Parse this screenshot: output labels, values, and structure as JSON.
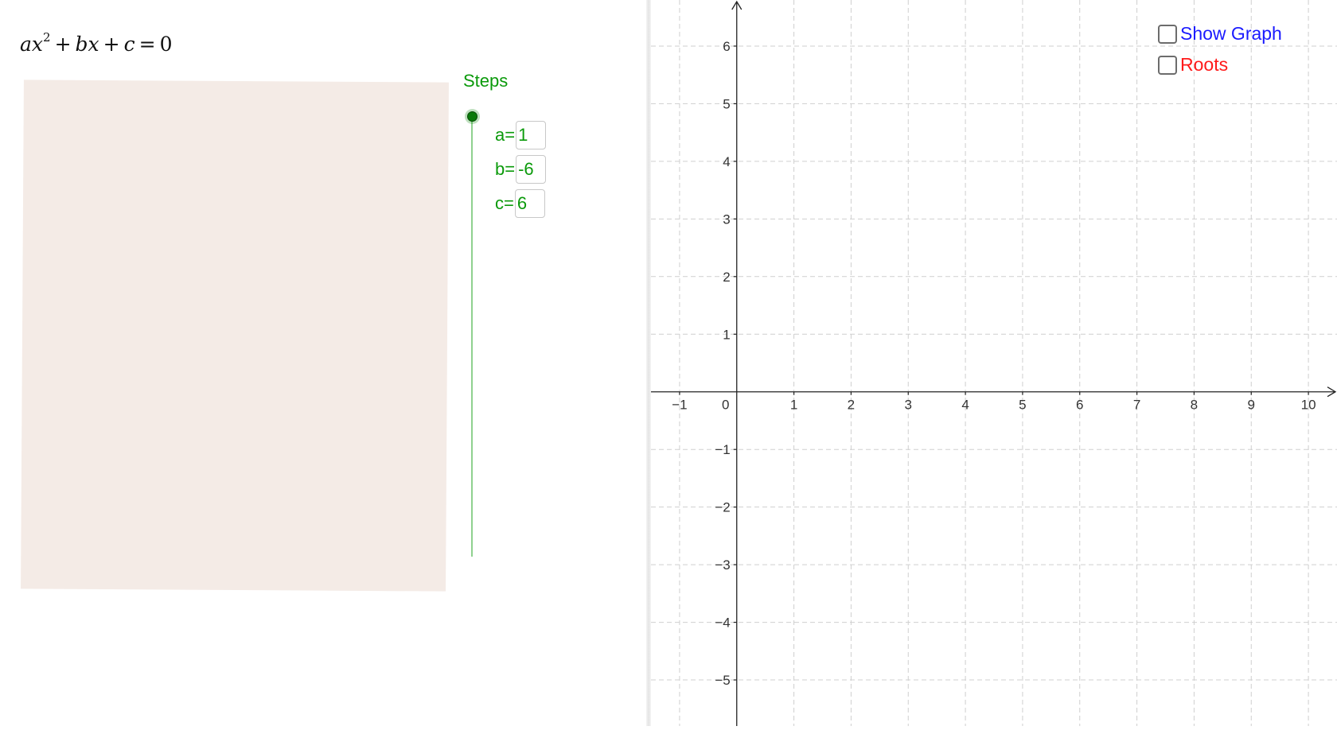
{
  "equation": {
    "a": "a",
    "x": "x",
    "exp": "2",
    "plus1": "+",
    "b": "b",
    "x2": "x",
    "plus2": "+",
    "c": "c",
    "eq": "=",
    "zero": "0"
  },
  "steps": {
    "label": "Steps"
  },
  "params": [
    {
      "label": "a=",
      "value": "1"
    },
    {
      "label": "b=",
      "value": "-6"
    },
    {
      "label": "c=",
      "value": "6"
    }
  ],
  "checkboxes": {
    "show_graph": {
      "label": "Show Graph",
      "checked": false,
      "color": "#1a1aff"
    },
    "roots": {
      "label": "Roots",
      "checked": false,
      "color": "#ff1a1a"
    }
  },
  "graph": {
    "x_range": [
      -1.5,
      10.5
    ],
    "y_range": [
      -5.8,
      6.8
    ],
    "x_tick_labels": [
      "−1",
      "0",
      "1",
      "2",
      "3",
      "4",
      "5",
      "6",
      "7",
      "8",
      "9",
      "10"
    ],
    "y_tick_labels": [
      "6",
      "5",
      "4",
      "3",
      "2",
      "1",
      "−1",
      "−2",
      "−3",
      "−4",
      "−5"
    ],
    "grid": true,
    "colors": {
      "grid": "#cfcfcf",
      "axis": "#222222",
      "tick_label": "#333333"
    }
  },
  "colors": {
    "accent": "#0b9a0b",
    "panel": "#f4ebe6"
  }
}
